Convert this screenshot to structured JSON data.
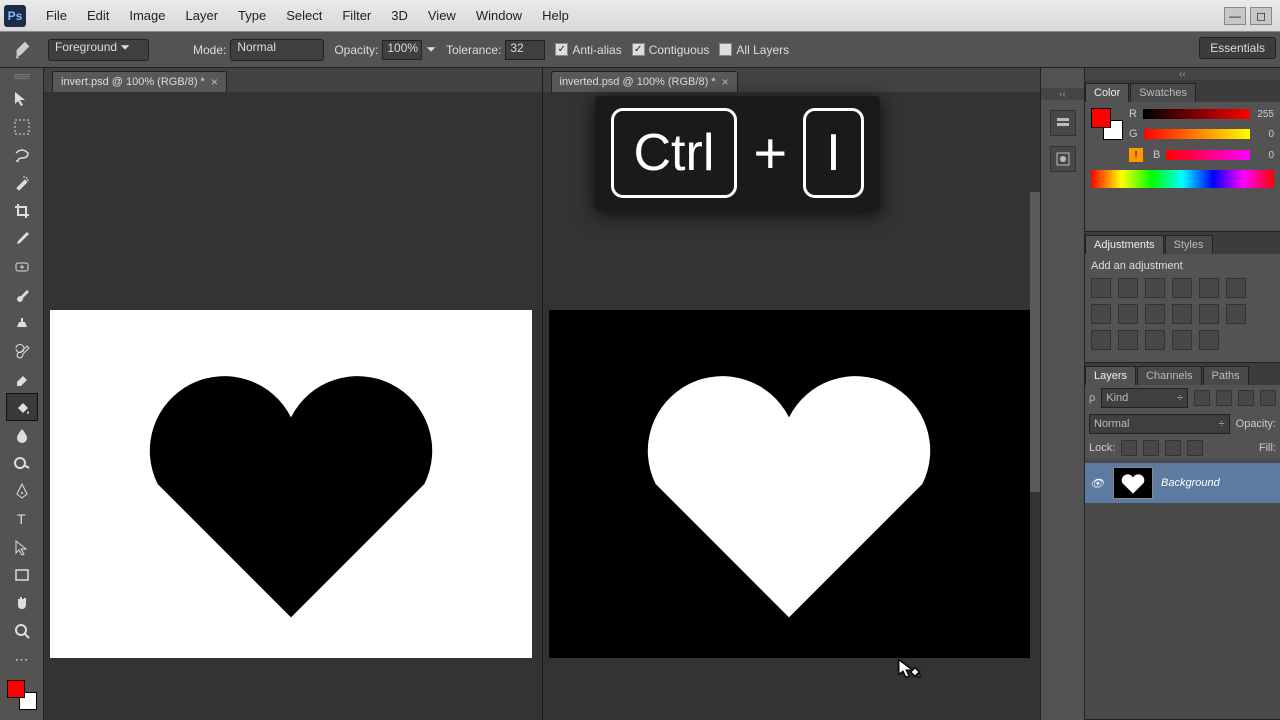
{
  "app_name": "Ps",
  "menu": [
    "File",
    "Edit",
    "Image",
    "Layer",
    "Type",
    "Select",
    "Filter",
    "3D",
    "View",
    "Window",
    "Help"
  ],
  "workspace_label": "Essentials",
  "options": {
    "fill_source_label": "Foreground",
    "mode_label": "Mode:",
    "mode_value": "Normal",
    "opacity_label": "Opacity:",
    "opacity_value": "100%",
    "tolerance_label": "Tolerance:",
    "tolerance_value": "32",
    "antialias_label": "Anti-alias",
    "antialias_checked": true,
    "contiguous_label": "Contiguous",
    "contiguous_checked": true,
    "alllayers_label": "All Layers",
    "alllayers_checked": false
  },
  "tabs": {
    "left": "invert.psd @ 100% (RGB/8) *",
    "right": "inverted.psd @ 100% (RGB/8) *"
  },
  "shortcut": {
    "key1": "Ctrl",
    "plus": "+",
    "key2": "I"
  },
  "color_panel": {
    "tab_color": "Color",
    "tab_swatches": "Swatches",
    "r_label": "R",
    "g_label": "G",
    "b_label": "B",
    "r_value": "255",
    "g_value": "0",
    "b_value": "0",
    "fg_hex": "#ff0000",
    "bg_hex": "#ffffff"
  },
  "adjustments": {
    "tab_adj": "Adjustments",
    "tab_styles": "Styles",
    "title": "Add an adjustment"
  },
  "layers": {
    "tab_layers": "Layers",
    "tab_channels": "Channels",
    "tab_paths": "Paths",
    "kind_label": "Kind",
    "blend_mode": "Normal",
    "opacity_label": "Opacity:",
    "lock_label": "Lock:",
    "fill_label": "Fill:",
    "items": [
      {
        "name": "Background"
      }
    ]
  }
}
